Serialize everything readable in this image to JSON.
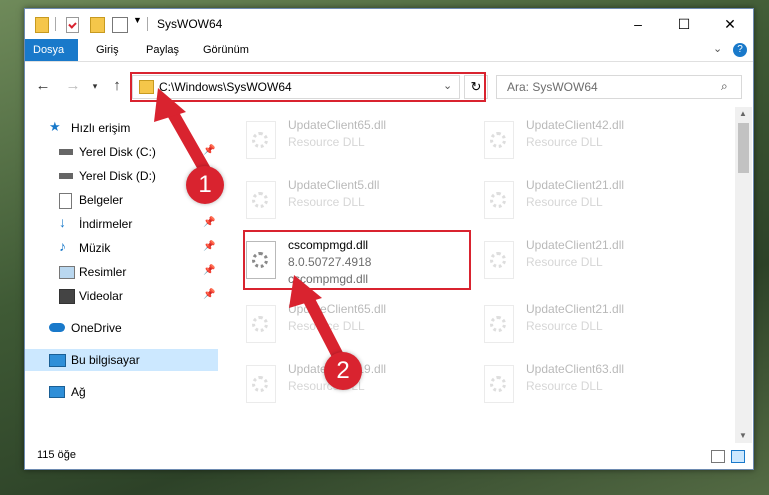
{
  "window": {
    "title": "SysWOW64"
  },
  "ribbon": {
    "tabs": [
      "Dosya",
      "Giriş",
      "Paylaş",
      "Görünüm"
    ]
  },
  "address": {
    "path": "C:\\Windows\\SysWOW64",
    "search_placeholder": "Ara: SysWOW64"
  },
  "sidebar": {
    "items": [
      {
        "label": "Hızlı erişim",
        "icon": "star-icon"
      },
      {
        "label": "Yerel Disk (C:)",
        "icon": "drive-icon",
        "pinned": true
      },
      {
        "label": "Yerel Disk (D:)",
        "icon": "drive-icon"
      },
      {
        "label": "Belgeler",
        "icon": "documents-icon"
      },
      {
        "label": "İndirmeler",
        "icon": "download-icon",
        "pinned": true
      },
      {
        "label": "Müzik",
        "icon": "music-icon",
        "pinned": true
      },
      {
        "label": "Resimler",
        "icon": "pictures-icon",
        "pinned": true
      },
      {
        "label": "Videolar",
        "icon": "video-icon",
        "pinned": true
      },
      {
        "label": "OneDrive",
        "icon": "cloud-icon"
      },
      {
        "label": "Bu bilgisayar",
        "icon": "computer-icon",
        "selected": true
      },
      {
        "label": "Ağ",
        "icon": "network-icon"
      }
    ]
  },
  "files": [
    {
      "name": "UpdateClient65.dll",
      "desc": "Resource DLL",
      "faded": true
    },
    {
      "name": "UpdateClient42.dll",
      "desc": "Resource DLL",
      "faded": true
    },
    {
      "name": "UpdateClient5.dll",
      "desc": "Resource DLL",
      "faded": true
    },
    {
      "name": "UpdateClient21.dll",
      "desc": "Resource DLL",
      "faded": true
    },
    {
      "name": "cscompmgd.dll",
      "version": "8.0.50727.4918",
      "desc": "cscompmgd.dll",
      "faded": false
    },
    {
      "name": "UpdateClient21.dll",
      "desc": "Resource DLL",
      "faded": true
    },
    {
      "name": "UpdateClient65.dll",
      "desc": "Resource DLL",
      "faded": true
    },
    {
      "name": "UpdateClient21.dll",
      "desc": "Resource DLL",
      "faded": true
    },
    {
      "name": "UpdateClient19.dll",
      "desc": "Resource DLL",
      "faded": true
    },
    {
      "name": "UpdateClient63.dll",
      "desc": "Resource DLL",
      "faded": true
    }
  ],
  "status": {
    "count": "115 öğe"
  },
  "annotations": {
    "step1": "1",
    "step2": "2"
  },
  "colors": {
    "accent": "#1979ca",
    "highlight": "#d9232f",
    "selected": "#cce8ff"
  }
}
